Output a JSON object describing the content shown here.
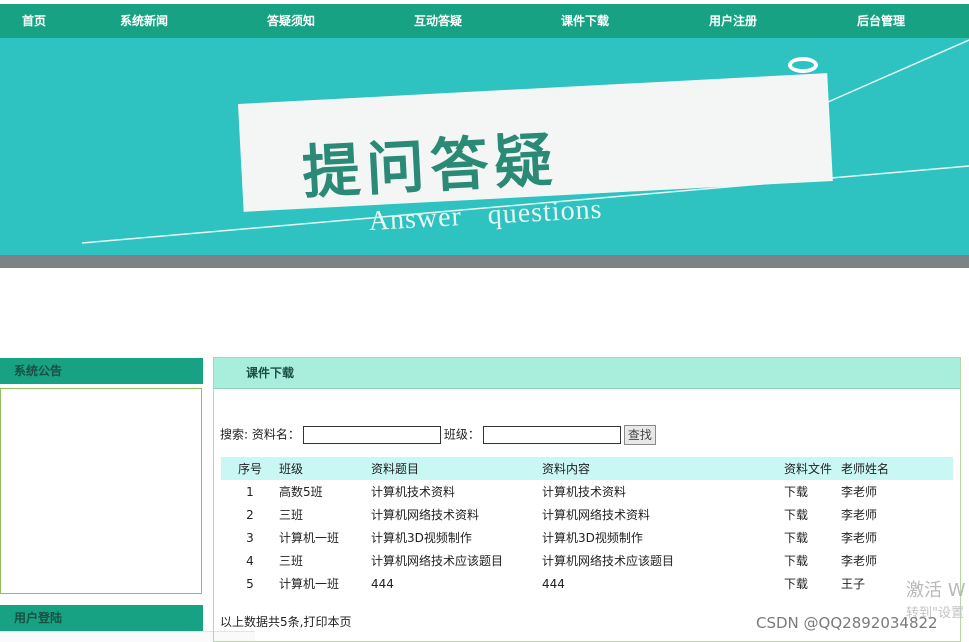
{
  "nav": {
    "items": [
      {
        "label": "首页"
      },
      {
        "label": "系统新闻"
      },
      {
        "label": "答疑须知"
      },
      {
        "label": "互动答疑"
      },
      {
        "label": "课件下载"
      },
      {
        "label": "用户注册"
      },
      {
        "label": "后台管理"
      }
    ]
  },
  "banner": {
    "title": "提问答疑",
    "subtitle": "Answer questions"
  },
  "sidebar": {
    "announcement_title": "系统公告",
    "login_title": "用户登陆"
  },
  "main": {
    "title": "课件下载",
    "search": {
      "label": "搜索: 资料名：",
      "class_label": "班级：",
      "name_value": "",
      "class_value": "",
      "button": "查找"
    },
    "table": {
      "headers": [
        "序号",
        "班级",
        "资料题目",
        "资料内容",
        "资料文件",
        "老师姓名"
      ],
      "rows": [
        [
          "1",
          "高数5班",
          "计算机技术资料",
          "计算机技术资料",
          "下载",
          "李老师"
        ],
        [
          "2",
          "三班",
          "计算机网络技术资料",
          "计算机网络技术资料",
          "下载",
          "李老师"
        ],
        [
          "3",
          "计算机一班",
          "计算机3D视频制作",
          "计算机3D视频制作",
          "下载",
          "李老师"
        ],
        [
          "4",
          "三班",
          "计算机网络技术应该题目",
          "计算机网络技术应该题目",
          "下载",
          "李老师"
        ],
        [
          "5",
          "计算机一班",
          "444",
          "444",
          "下载",
          "王子"
        ]
      ]
    },
    "footer": "以上数据共5条,打印本页"
  },
  "watermark": {
    "csdn": "CSDN @QQ2892034822",
    "activate": "激活 W",
    "activate_sub": "转到\"设置"
  },
  "colors": {
    "nav_bg": "#17a383",
    "banner_bg": "#2ec3c0",
    "panel_header_bg": "#a9eedc",
    "table_header_bg": "#c9f7f4"
  }
}
